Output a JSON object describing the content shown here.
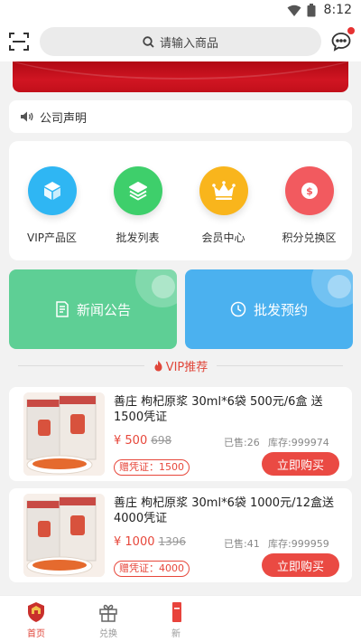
{
  "status_bar": {
    "time": "8:12"
  },
  "header": {
    "search_placeholder": "请输入商品",
    "icons": [
      "scan-icon",
      "search-icon",
      "chat-icon"
    ]
  },
  "notice": {
    "text": "公司声明",
    "icon": "speaker-icon"
  },
  "shortcuts": [
    {
      "label": "VIP产品区",
      "icon": "cube-icon",
      "color": "#2fb6f3"
    },
    {
      "label": "批发列表",
      "icon": "layers-icon",
      "color": "#3ecf6b"
    },
    {
      "label": "会员中心",
      "icon": "crown-icon",
      "color": "#f9b51c"
    },
    {
      "label": "积分兑换区",
      "icon": "coin-icon",
      "color": "#f25a5f"
    }
  ],
  "big_buttons": {
    "news": {
      "label": "新闻公告",
      "icon": "document-icon",
      "color": "#5ecf95"
    },
    "booking": {
      "label": "批发预约",
      "icon": "clock-icon",
      "color": "#4bb1ef"
    }
  },
  "section": {
    "title": "VIP推荐"
  },
  "products": [
    {
      "name": "善庄 枸杞原浆 30ml*6袋 500元/6盒 送1500凭证",
      "price": "¥ 500",
      "orig_price": "698",
      "sold": "已售:26",
      "stock": "库存:999974",
      "gift": "赠凭证：1500",
      "buy_label": "立即购买"
    },
    {
      "name": "善庄 枸杞原浆 30ml*6袋 1000元/12盒送4000凭证",
      "price": "¥ 1000",
      "orig_price": "1396",
      "sold": "已售:41",
      "stock": "库存:999959",
      "gift": "赠凭证：4000",
      "buy_label": "立即购买"
    }
  ],
  "tab_bar": [
    {
      "label": "首页",
      "icon": "home-emblem-icon",
      "active": true
    },
    {
      "label": "兑换",
      "icon": "gift-icon",
      "active": false
    },
    {
      "label": "新",
      "icon": "new-icon",
      "active": false
    }
  ],
  "colors": {
    "accent": "#e7473b",
    "banner": "#c20f1a"
  }
}
